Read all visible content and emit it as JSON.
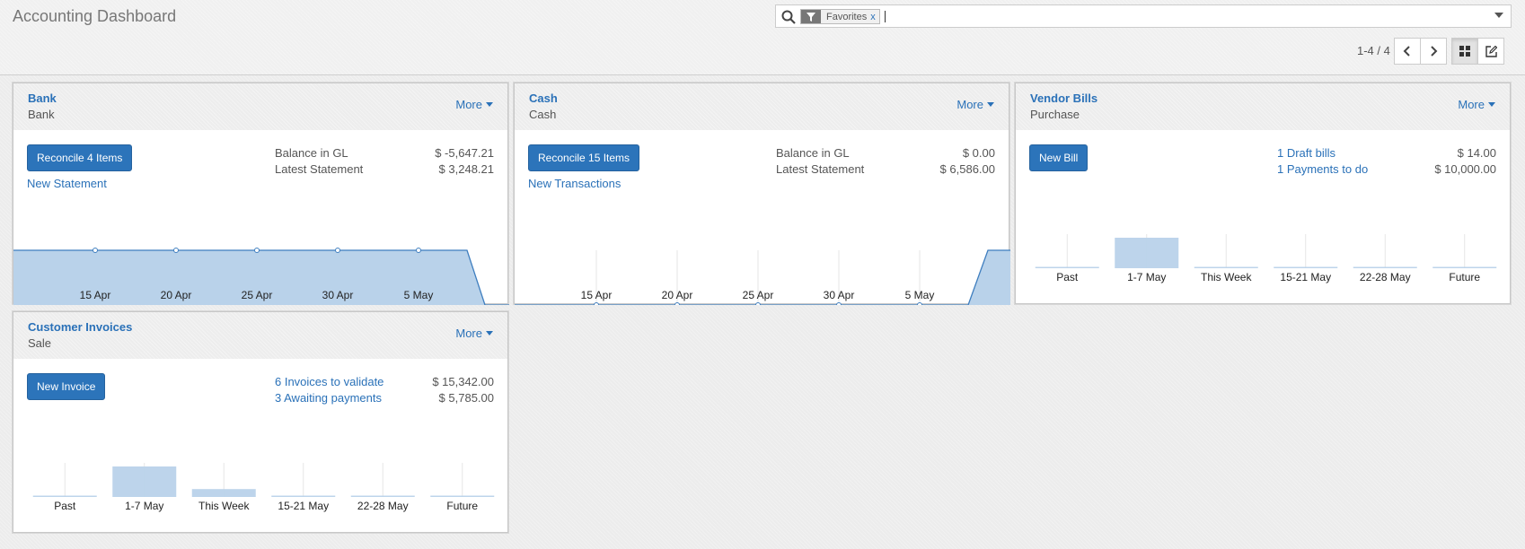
{
  "header": {
    "title": "Accounting Dashboard",
    "search": {
      "facet_label": "Favorites",
      "facet_close": "x",
      "value": "",
      "placeholder": ""
    },
    "pager": "1-4 / 4"
  },
  "colors": {
    "brand": "#2a71b8",
    "button": "#2c74ba",
    "chart_fill": "#b9d2ea",
    "chart_line": "#3f7ebf"
  },
  "icons": [
    "search-icon",
    "filter-icon",
    "chevron-left-icon",
    "chevron-right-icon",
    "kanban-icon",
    "edit-icon",
    "caret-down-icon"
  ],
  "cards": {
    "bank": {
      "title": "Bank",
      "subtitle": "Bank",
      "more": "More",
      "action": "Reconcile 4 Items",
      "link": "New Statement",
      "rows": [
        {
          "label": "Balance in GL",
          "amount": "$ -5,647.21"
        },
        {
          "label": "Latest Statement",
          "amount": "$ 3,248.21"
        }
      ]
    },
    "cash": {
      "title": "Cash",
      "subtitle": "Cash",
      "more": "More",
      "action": "Reconcile 15 Items",
      "link": "New Transactions",
      "rows": [
        {
          "label": "Balance in GL",
          "amount": "$ 0.00"
        },
        {
          "label": "Latest Statement",
          "amount": "$ 6,586.00"
        }
      ]
    },
    "vendor": {
      "title": "Vendor Bills",
      "subtitle": "Purchase",
      "more": "More",
      "action": "New Bill",
      "rows": [
        {
          "label": "1 Draft bills",
          "amount": "$ 14.00"
        },
        {
          "label": "1 Payments to do",
          "amount": "$ 10,000.00"
        }
      ]
    },
    "customer": {
      "title": "Customer Invoices",
      "subtitle": "Sale",
      "more": "More",
      "action": "New Invoice",
      "rows": [
        {
          "label": "6 Invoices to validate",
          "amount": "$ 15,342.00"
        },
        {
          "label": "3 Awaiting payments",
          "amount": "$ 5,785.00"
        }
      ]
    }
  },
  "chart_data": [
    {
      "type": "area",
      "card": "Bank",
      "x": [
        "15 Apr",
        "20 Apr",
        "25 Apr",
        "30 Apr",
        "5 May"
      ],
      "series": [
        {
          "values": [
            -5647.21,
            -5647.21,
            -5647.21,
            -5647.21,
            -5647.21
          ]
        }
      ],
      "end_drop": true
    },
    {
      "type": "area",
      "card": "Cash",
      "x": [
        "15 Apr",
        "20 Apr",
        "25 Apr",
        "30 Apr",
        "5 May"
      ],
      "series": [
        {
          "values": [
            0,
            0,
            0,
            0,
            0
          ]
        }
      ],
      "end_rise": true
    },
    {
      "type": "bar",
      "card": "Vendor Bills",
      "categories": [
        "Past",
        "1-7 May",
        "This Week",
        "15-21 May",
        "22-28 May",
        "Future"
      ],
      "values": [
        0,
        10000,
        0,
        0,
        0,
        0
      ]
    },
    {
      "type": "bar",
      "card": "Customer Invoices",
      "categories": [
        "Past",
        "1-7 May",
        "This Week",
        "15-21 May",
        "22-28 May",
        "Future"
      ],
      "values": [
        0,
        5785,
        1500,
        0,
        0,
        0
      ]
    }
  ]
}
